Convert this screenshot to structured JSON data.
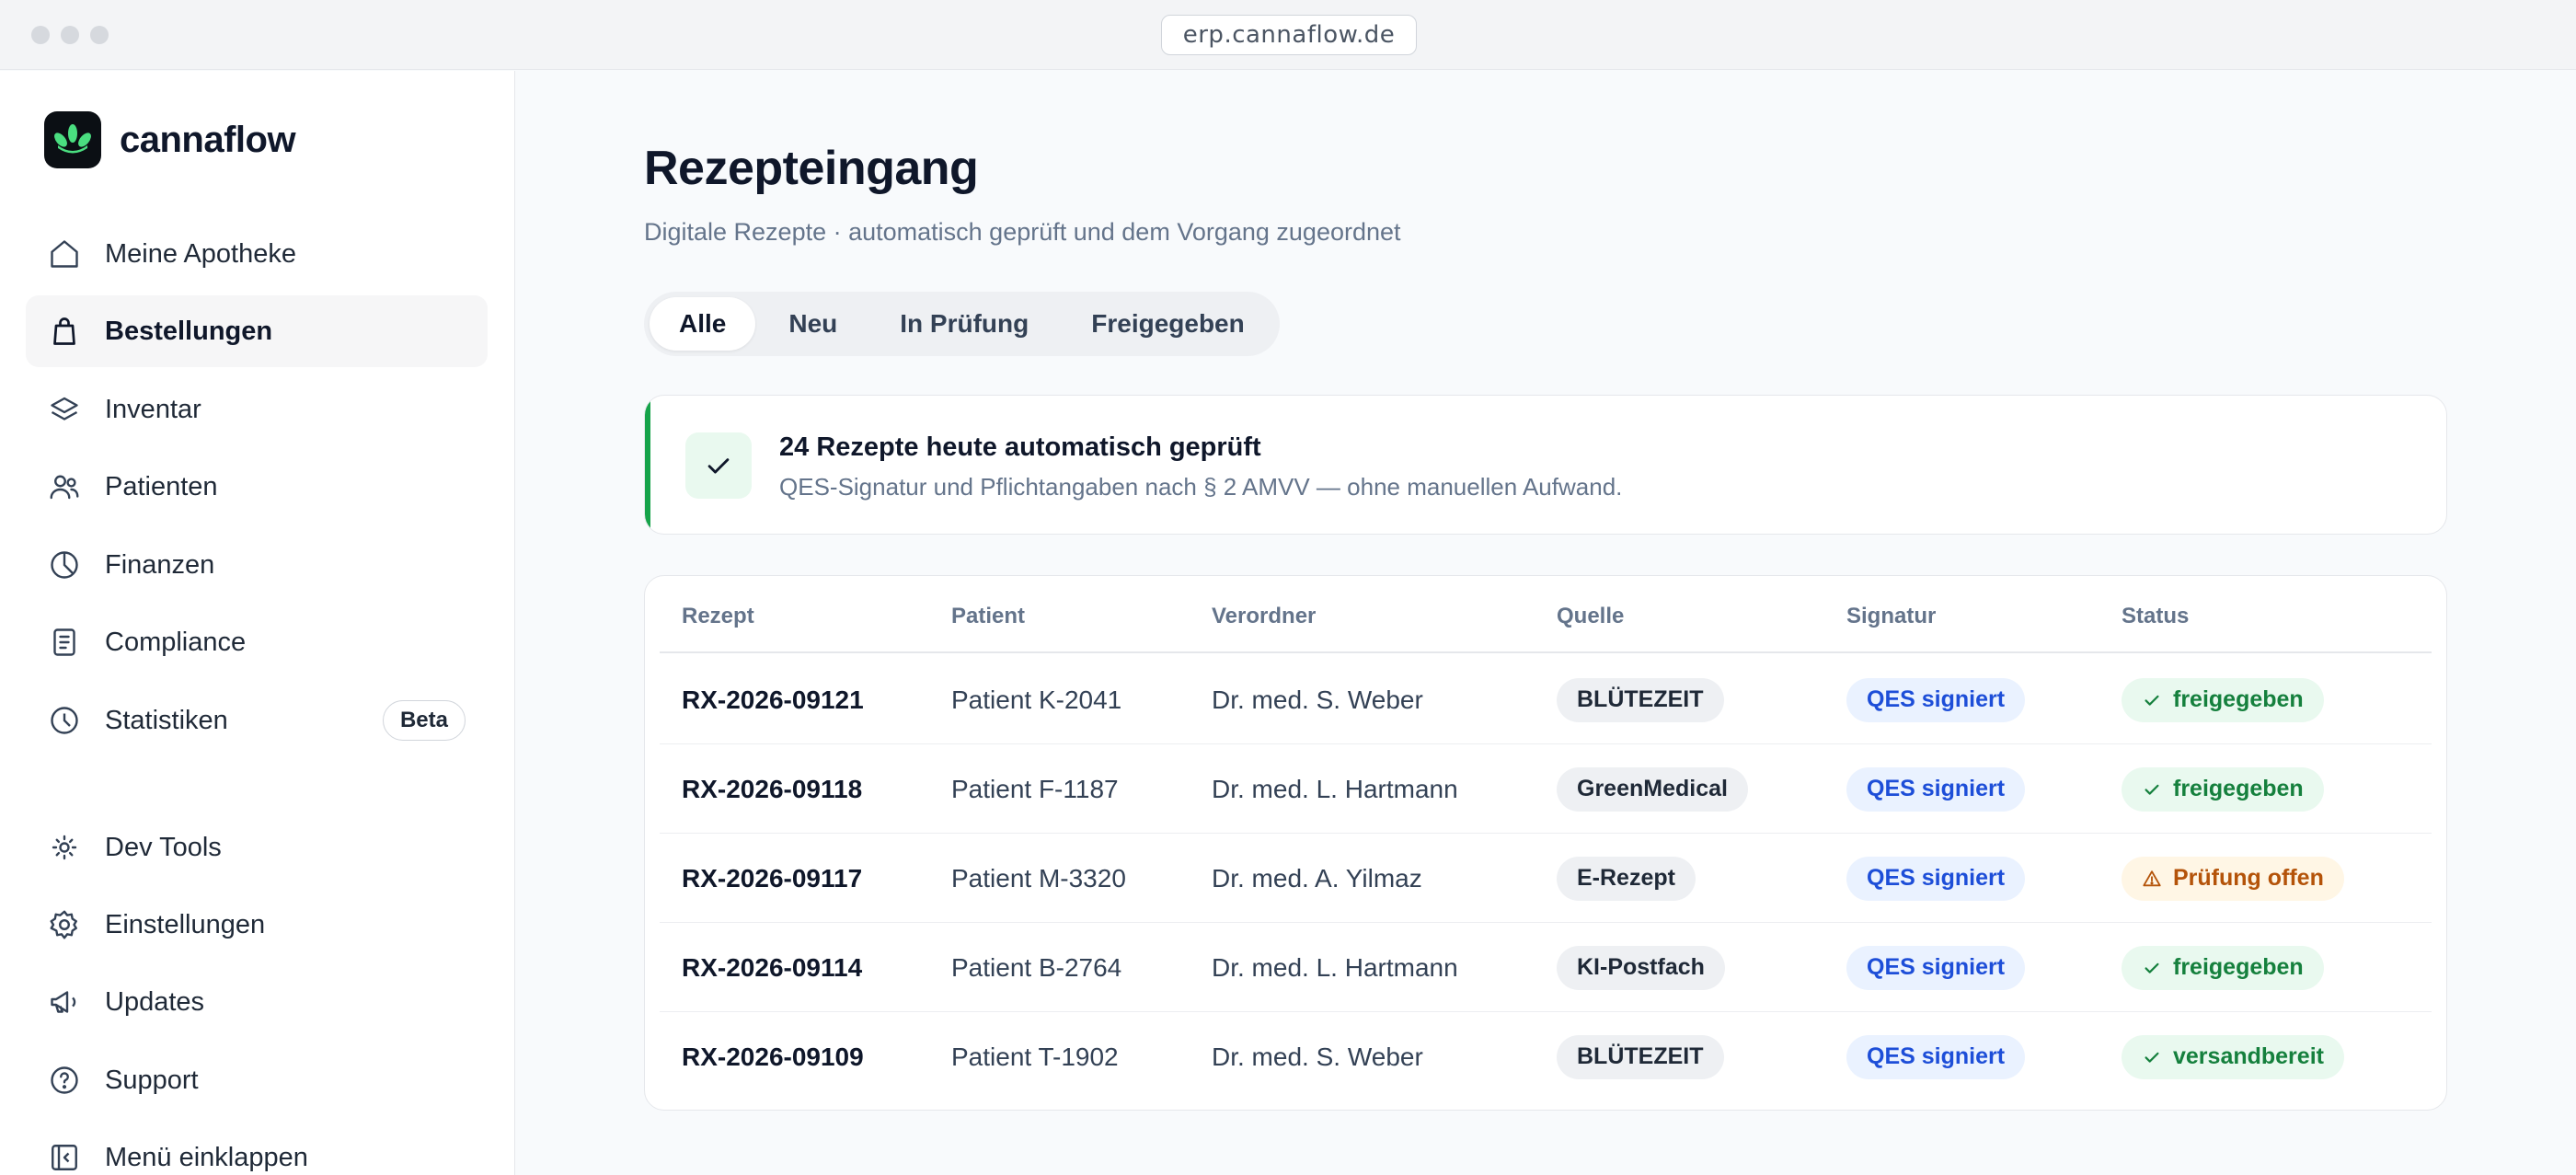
{
  "browser": {
    "url": "erp.cannaflow.de"
  },
  "brand": {
    "name": "cannaflow",
    "logo_icon": "leaf-logo-icon"
  },
  "sidebar": {
    "items": [
      {
        "label": "Meine Apotheke",
        "icon": "home-icon",
        "active": false
      },
      {
        "label": "Bestellungen",
        "icon": "shopping-bag-icon",
        "active": true
      },
      {
        "label": "Inventar",
        "icon": "layers-icon",
        "active": false
      },
      {
        "label": "Patienten",
        "icon": "users-icon",
        "active": false
      },
      {
        "label": "Finanzen",
        "icon": "pie-chart-icon",
        "active": false
      },
      {
        "label": "Compliance",
        "icon": "document-icon",
        "active": false
      },
      {
        "label": "Statistiken",
        "icon": "clock-chart-icon",
        "active": false,
        "badge": "Beta"
      },
      {
        "label": "Dev Tools",
        "icon": "dev-tools-icon",
        "active": false
      },
      {
        "label": "Einstellungen",
        "icon": "gear-icon",
        "active": false
      },
      {
        "label": "Updates",
        "icon": "megaphone-icon",
        "active": false
      },
      {
        "label": "Support",
        "icon": "help-circle-icon",
        "active": false
      },
      {
        "label": "Menü einklappen",
        "icon": "collapse-icon",
        "active": false
      }
    ]
  },
  "header": {
    "title": "Rezepteingang",
    "subtitle": "Digitale Rezepte · automatisch geprüft und dem Vorgang zugeordnet"
  },
  "tabs": [
    {
      "label": "Alle",
      "active": true
    },
    {
      "label": "Neu",
      "active": false
    },
    {
      "label": "In Prüfung",
      "active": false
    },
    {
      "label": "Freigegeben",
      "active": false
    }
  ],
  "banner": {
    "title": "24 Rezepte heute automatisch geprüft",
    "text": "QES-Signatur und Pflichtangaben nach § 2 AMVV — ohne manuellen Aufwand.",
    "accent": "#16a34a"
  },
  "table": {
    "columns": [
      "Rezept",
      "Patient",
      "Verordner",
      "Quelle",
      "Signatur",
      "Status"
    ],
    "rows": [
      {
        "id": "RX-2026-09121",
        "patient": "Patient K-2041",
        "prescriber": "Dr. med. S. Weber",
        "source": "BLÜTEZEIT",
        "signature": "QES signiert",
        "status": "freigegeben",
        "status_type": "ok"
      },
      {
        "id": "RX-2026-09118",
        "patient": "Patient F-1187",
        "prescriber": "Dr. med. L. Hartmann",
        "source": "GreenMedical",
        "signature": "QES signiert",
        "status": "freigegeben",
        "status_type": "ok"
      },
      {
        "id": "RX-2026-09117",
        "patient": "Patient M-3320",
        "prescriber": "Dr. med. A. Yilmaz",
        "source": "E-Rezept",
        "signature": "QES signiert",
        "status": "Prüfung offen",
        "status_type": "warn"
      },
      {
        "id": "RX-2026-09114",
        "patient": "Patient B-2764",
        "prescriber": "Dr. med. L. Hartmann",
        "source": "KI-Postfach",
        "signature": "QES signiert",
        "status": "freigegeben",
        "status_type": "ok"
      },
      {
        "id": "RX-2026-09109",
        "patient": "Patient T-1902",
        "prescriber": "Dr. med. S. Weber",
        "source": "BLÜTEZEIT",
        "signature": "QES signiert",
        "status": "versandbereit",
        "status_type": "ok"
      }
    ]
  },
  "colors": {
    "success": "#15803d",
    "warning": "#b45309",
    "signature": "#1d4ed8"
  }
}
